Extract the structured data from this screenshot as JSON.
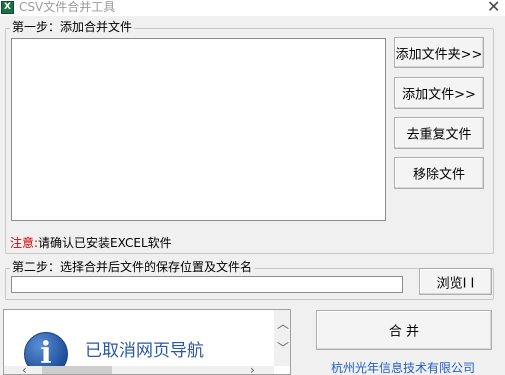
{
  "window": {
    "title": "CSV文件合并工具"
  },
  "step1": {
    "label": "第一步：添加合并文件",
    "buttons": {
      "add_folder": "添加文件夹>>",
      "add_file": "添加文件>>",
      "dedupe": "去重复文件",
      "remove": "移除文件"
    }
  },
  "notice": {
    "prefix": "注意:",
    "text": "请确认已安装EXCEL软件"
  },
  "step2": {
    "label": "第二步：选择合并后文件的保存位置及文件名",
    "path_value": "",
    "browse": "浏览I I"
  },
  "nav_panel": {
    "message": "已取消网页导航"
  },
  "merge_button": "合 并",
  "company_link": "杭州光年信息技术有限公司",
  "colors": {
    "warning": "#d40000",
    "link": "#1f5fbf",
    "icon_blue": "#1f4f9b"
  }
}
